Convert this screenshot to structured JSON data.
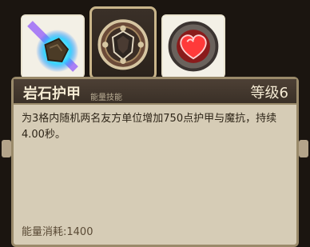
{
  "skill": {
    "name": "岩石护甲",
    "category": "能量技能",
    "level": "等级6",
    "description": "为3格内随机两名友方单位增加750点护甲与魔抗，持续4.00秒。",
    "energy_cost": "能量消耗:1400"
  },
  "icons": [
    {
      "name": "rock-meteor-icon",
      "selected": false
    },
    {
      "name": "shield-emblem-icon",
      "selected": true
    },
    {
      "name": "heart-gem-icon",
      "selected": false
    }
  ],
  "colors": {
    "panel_bg": "#d6ccb6",
    "header_bg": "#3a3027",
    "border": "#9a8a6a"
  }
}
